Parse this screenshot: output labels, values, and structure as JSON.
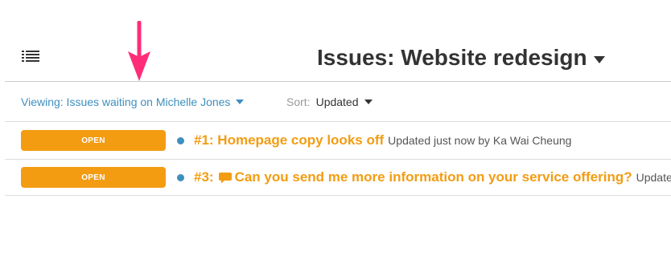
{
  "header": {
    "title": "Issues: Website redesign",
    "menu_icon": "list-icon",
    "title_dropdown_icon": "caret-down-icon"
  },
  "annotation": {
    "icon": "arrow-down-icon",
    "color": "#ff2d78"
  },
  "filters": {
    "viewing": "Viewing: Issues waiting on Michelle Jones",
    "sort_label": "Sort:",
    "sort_value": "Updated"
  },
  "issues": [
    {
      "status": "OPEN",
      "number_title": "#1: Homepage copy looks off",
      "meta": "Updated just now by Ka Wai Cheung",
      "has_comment_icon": false
    },
    {
      "status": "OPEN",
      "number": "#3:",
      "title": "Can you send me more information on your service offering?",
      "meta": "Updated",
      "has_comment_icon": true
    }
  ],
  "colors": {
    "accent_orange": "#f39c12",
    "link_blue": "#3d8fbf",
    "arrow_pink": "#ff2d78",
    "text_dark": "#333333"
  }
}
